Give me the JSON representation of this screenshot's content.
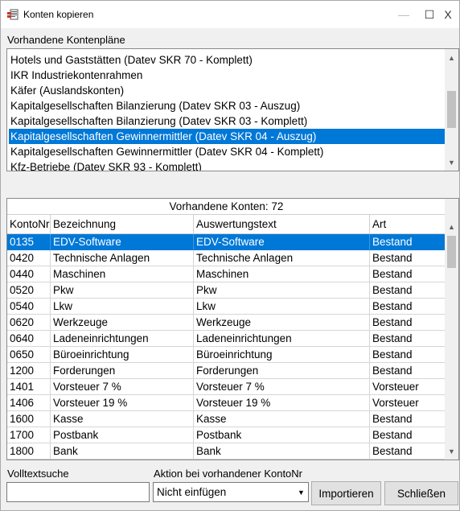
{
  "window": {
    "title": "Konten kopieren"
  },
  "titlebar": {
    "minimize_glyph": "—",
    "maximize_glyph": "☐",
    "close_glyph": "X"
  },
  "kontenplaene": {
    "label": "Vorhandene Kontenpläne",
    "items": [
      "Hotels und Gaststätten (Datev SKR 70 - Komplett)",
      "IKR Industriekontenrahmen",
      "Käfer (Auslandskonten)",
      "Kapitalgesellschaften Bilanzierung (Datev SKR 03 - Auszug)",
      "Kapitalgesellschaften Bilanzierung (Datev SKR 03 - Komplett)",
      "Kapitalgesellschaften Gewinnermittler (Datev SKR 04 - Auszug)",
      "Kapitalgesellschaften Gewinnermittler (Datev SKR 04 - Komplett)",
      "Kfz-Betriebe (Datev SKR 93 - Komplett)"
    ],
    "selected_index": 5
  },
  "konten": {
    "caption": "Vorhandene Konten: 72",
    "columns": [
      "KontoNr",
      "Bezeichnung",
      "Auswertungstext",
      "Art"
    ],
    "selected_index": 0,
    "rows": [
      [
        "0135",
        "EDV-Software",
        "EDV-Software",
        "Bestand"
      ],
      [
        "0420",
        "Technische Anlagen",
        "Technische Anlagen",
        "Bestand"
      ],
      [
        "0440",
        "Maschinen",
        "Maschinen",
        "Bestand"
      ],
      [
        "0520",
        "Pkw",
        "Pkw",
        "Bestand"
      ],
      [
        "0540",
        "Lkw",
        "Lkw",
        "Bestand"
      ],
      [
        "0620",
        "Werkzeuge",
        "Werkzeuge",
        "Bestand"
      ],
      [
        "0640",
        "Ladeneinrichtungen",
        "Ladeneinrichtungen",
        "Bestand"
      ],
      [
        "0650",
        "Büroeinrichtung",
        "Büroeinrichtung",
        "Bestand"
      ],
      [
        "1200",
        "Forderungen",
        "Forderungen",
        "Bestand"
      ],
      [
        "1401",
        "Vorsteuer 7 %",
        "Vorsteuer 7 %",
        "Vorsteuer"
      ],
      [
        "1406",
        "Vorsteuer 19 %",
        "Vorsteuer 19 %",
        "Vorsteuer"
      ],
      [
        "1600",
        "Kasse",
        "Kasse",
        "Bestand"
      ],
      [
        "1700",
        "Postbank",
        "Postbank",
        "Bestand"
      ],
      [
        "1800",
        "Bank",
        "Bank",
        "Bestand"
      ]
    ]
  },
  "volltextsuche": {
    "label": "Volltextsuche",
    "value": ""
  },
  "aktion": {
    "label": "Aktion bei vorhandener KontoNr",
    "value": "Nicht einfügen"
  },
  "buttons": {
    "import": "Importieren",
    "close": "Schließen"
  },
  "colors": {
    "selection": "#0078d7"
  }
}
